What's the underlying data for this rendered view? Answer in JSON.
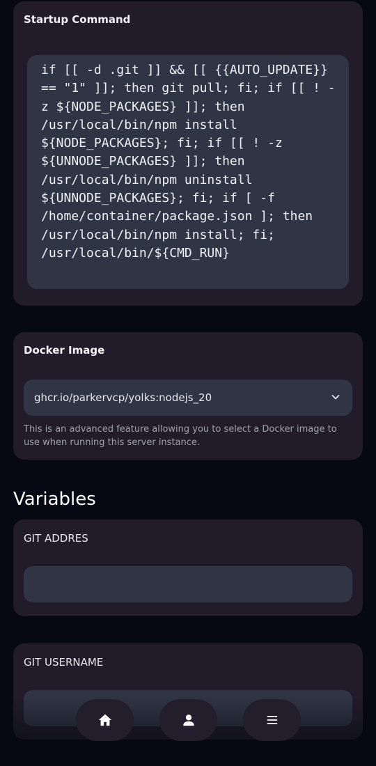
{
  "startup": {
    "title": "Startup Command",
    "command": "if [[ -d .git ]] && [[ {{AUTO_UPDATE}} == \"1\" ]]; then git pull; fi; if [[ ! -z ${NODE_PACKAGES} ]]; then /usr/local/bin/npm install ${NODE_PACKAGES}; fi; if [[ ! -z ${UNNODE_PACKAGES} ]]; then /usr/local/bin/npm uninstall ${UNNODE_PACKAGES}; fi; if [ -f /home/container/package.json ]; then /usr/local/bin/npm install; fi; /usr/local/bin/${CMD_RUN}"
  },
  "docker": {
    "title": "Docker Image",
    "selected": "ghcr.io/parkervcp/yolks:nodejs_20",
    "help": "This is an advanced feature allowing you to select a Docker image to use when running this server instance."
  },
  "variables": {
    "heading": "Variables",
    "items": [
      {
        "label": "GIT ADDRES",
        "value": ""
      },
      {
        "label": "GIT USERNAME",
        "value": ""
      }
    ]
  },
  "nav": {
    "items": [
      {
        "icon": "home-icon"
      },
      {
        "icon": "user-icon"
      },
      {
        "icon": "menu-icon"
      }
    ]
  },
  "colors": {
    "background": "#060913",
    "card": "#221b2a",
    "field": "#2f3544",
    "muted_text": "#9ea1ad"
  }
}
